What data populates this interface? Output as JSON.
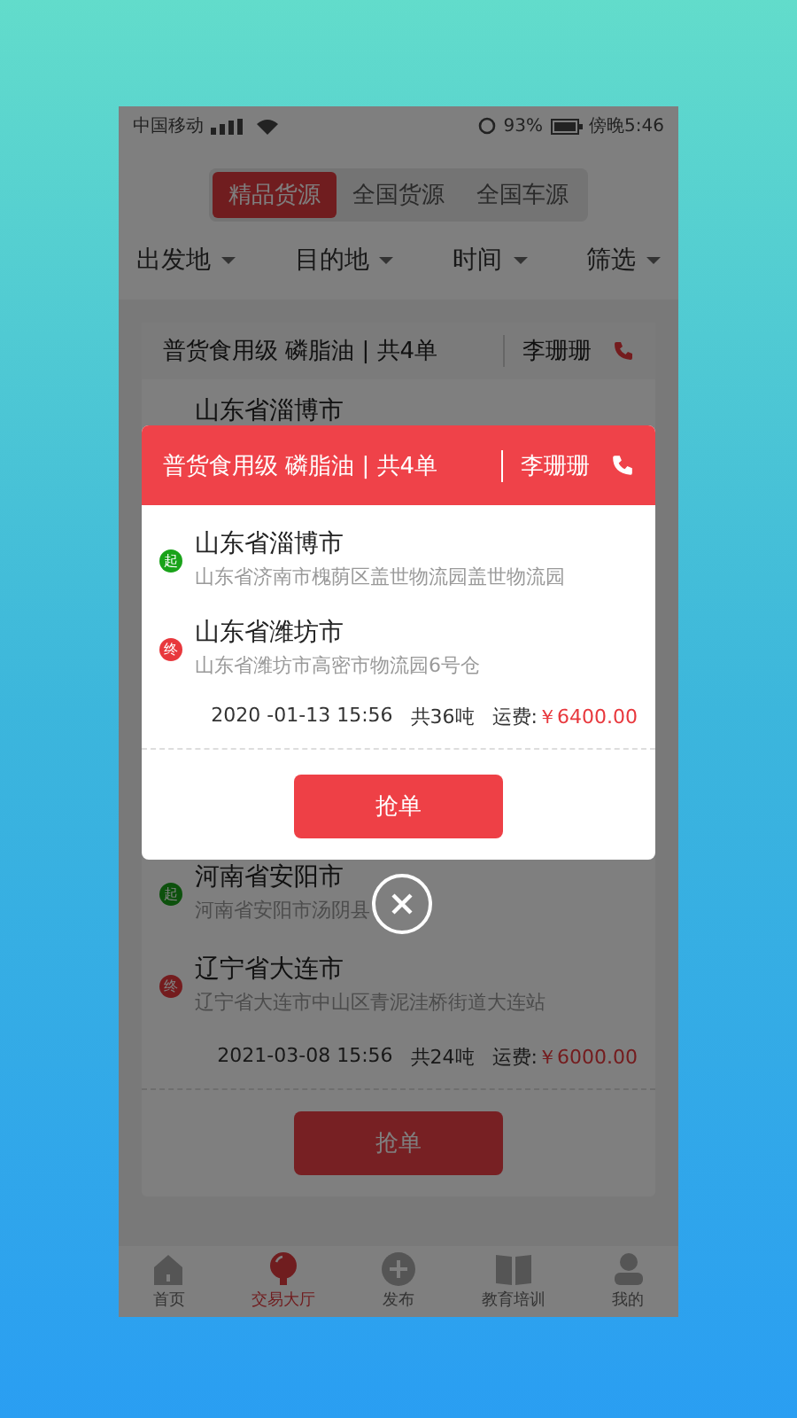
{
  "status_bar": {
    "carrier": "中国移动",
    "battery": "93%",
    "time": "傍晚5:46"
  },
  "tabs": [
    {
      "label": "精品货源",
      "selected": true
    },
    {
      "label": "全国货源",
      "selected": false
    },
    {
      "label": "全国车源",
      "selected": false
    }
  ],
  "filters": [
    {
      "label": "出发地"
    },
    {
      "label": "目的地"
    },
    {
      "label": "时间"
    },
    {
      "label": "筛选"
    }
  ],
  "order_card": {
    "title": "普货食用级 磷脂油 | 共4单",
    "contact": "李珊珊",
    "first_city": "山东省淄博市",
    "routes": [
      {
        "kind": "start",
        "badge": "起",
        "city": "河南省安阳市",
        "address": "河南省安阳市汤阴县"
      },
      {
        "kind": "end",
        "badge": "终",
        "city": "辽宁省大连市",
        "address": "辽宁省大连市中山区青泥洼桥街道大连站"
      }
    ],
    "date": "2021-03-08 15:56",
    "weight": "共24吨",
    "fee_label": "运费:",
    "fee": "￥6000.00",
    "button": "抢单"
  },
  "modal": {
    "title": "普货食用级 磷脂油 | 共4单",
    "contact": "李珊珊",
    "routes": [
      {
        "kind": "start",
        "badge": "起",
        "city": "山东省淄博市",
        "address": "山东省济南市槐荫区盖世物流园盖世物流园"
      },
      {
        "kind": "end",
        "badge": "终",
        "city": "山东省潍坊市",
        "address": "山东省潍坊市高密市物流园6号仓"
      }
    ],
    "date": "2020 -01-13 15:56",
    "weight": "共36吨",
    "fee_label": "运费:",
    "fee": "￥6400.00",
    "button": "抢单"
  },
  "tab_bar": [
    {
      "label": "首页",
      "selected": false
    },
    {
      "label": "交易大厅",
      "selected": true
    },
    {
      "label": "发布",
      "selected": false
    },
    {
      "label": "教育培训",
      "selected": false
    },
    {
      "label": "我的",
      "selected": false
    }
  ]
}
